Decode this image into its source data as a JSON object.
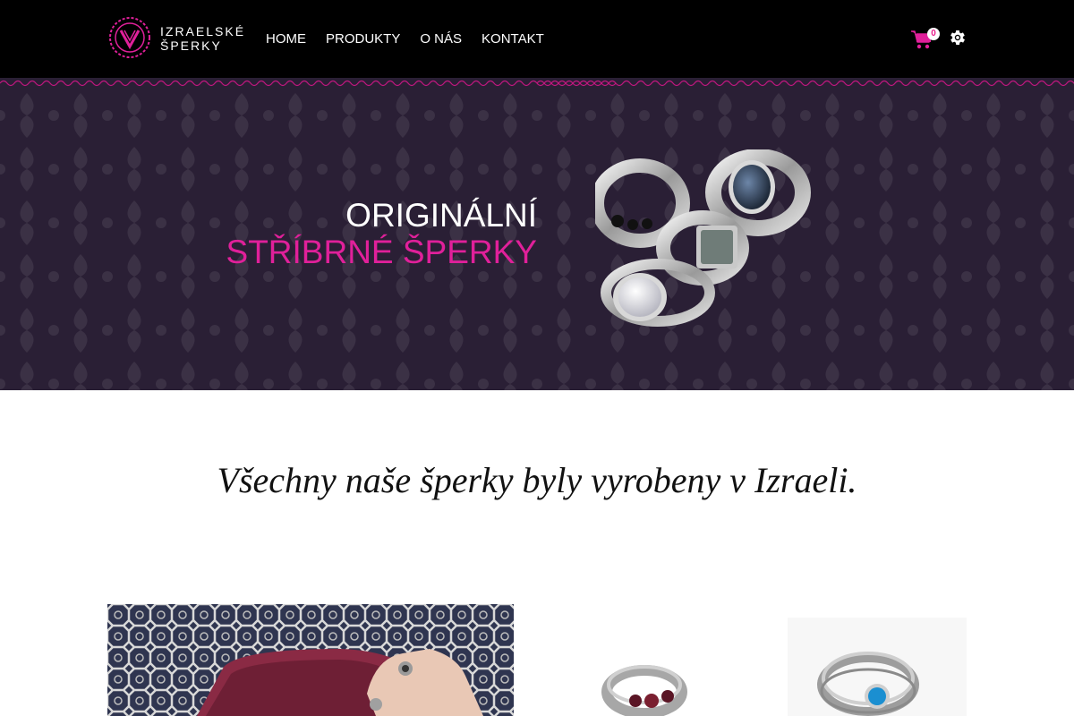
{
  "header": {
    "logo": {
      "line1": "IZRAELSKÉ",
      "line2": "ŠPERKY",
      "icon": "v-monogram-icon"
    },
    "nav": [
      "HOME",
      "PRODUKTY",
      "O NÁS",
      "KONTAKT"
    ],
    "cart": {
      "icon": "shopping-cart-icon",
      "count": "0"
    },
    "settings": {
      "icon": "gear-icon"
    }
  },
  "hero": {
    "line1": "ORIGINÁLNÍ",
    "line2": "STŘÍBRNÉ ŠPERKY",
    "image": "silver-rings-image"
  },
  "tagline": "Všechny naše šperky byly vyrobeny v Izraeli.",
  "products": [
    {
      "image": "hand-with-rings-photo"
    },
    {
      "image": "ring-red-stones-image"
    },
    {
      "image": "ring-turquoise-stone-image"
    }
  ],
  "colors": {
    "header_bg": "#000000",
    "hero_bg": "#2a1f35",
    "accent": "#e0209a",
    "text": "#111111"
  }
}
